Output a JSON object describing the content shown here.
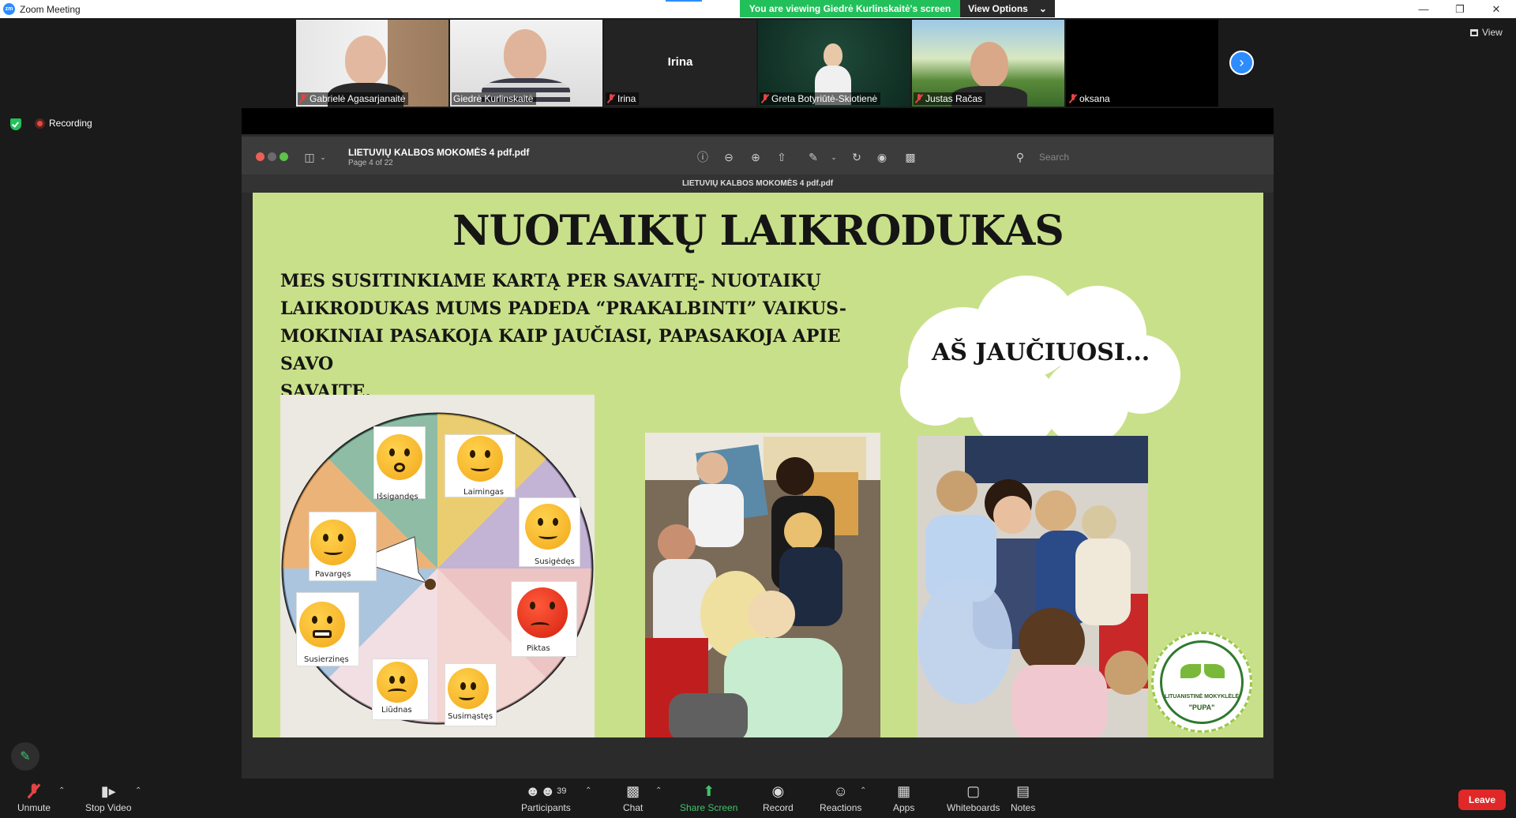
{
  "window": {
    "app_logo": "zm",
    "title": "Zoom Meeting",
    "controls": [
      "minimize-icon",
      "restore-icon",
      "close-icon"
    ]
  },
  "banner": {
    "viewing_text": "You are viewing Giedrė Kurlinskaitė's screen",
    "view_options_label": "View Options",
    "banner_color": "#22c05a"
  },
  "gallery": {
    "tiles": [
      {
        "name": "Gabrielė Agasarjanaitė",
        "muted": true,
        "video": true
      },
      {
        "name": "Giedrė Kurlinskaitė",
        "muted": false,
        "video": true,
        "active_speaker": true
      },
      {
        "name": "Irina",
        "muted": true,
        "video": false,
        "center_name": "Irina"
      },
      {
        "name": "Greta Botyriūtė-Skiotienė",
        "muted": true,
        "video": true
      },
      {
        "name": "Justas Račas",
        "muted": true,
        "video": true
      },
      {
        "name": "oksana",
        "muted": true,
        "video": false
      }
    ],
    "view_label": "View"
  },
  "status": {
    "recording_label": "Recording",
    "recording_color": "#e8483f"
  },
  "preview": {
    "file_name": "LIETUVIŲ KALBOS MOKOMĖS 4 pdf.pdf",
    "page_info": "Page 4 of 22",
    "tab_title": "LIETUVIŲ KALBOS MOKOMĖS 4 pdf.pdf",
    "search_placeholder": "Search"
  },
  "slide": {
    "title": "NUOTAIKŲ LAIKRODUKAS",
    "body_lines": [
      "MES SUSITINKIAME KARTĄ PER SAVAITĘ- NUOTAIKŲ",
      "LAIKRODUKAS MUMS PADEDA  “PRAKALBINTI” VAIKUS-",
      "MOKINIAI PASAKOJA KAIP JAUČIASI, PAPASAKOJA APIE SAVO",
      "SAVAITĘ."
    ],
    "cloud_text": "AŠ JAUČIUOSI...",
    "emotions": [
      "Išsigandęs",
      "Laimingas",
      "Pavargęs",
      "Susigėdęs",
      "Piktas",
      "Susierzinęs",
      "Liūdnas",
      "Susimąstęs"
    ],
    "logo_line1": "LITUANISTINĖ MOKYKLĖLĖ",
    "logo_line2": "\"PUPA\"",
    "background_color": "#c9e08a"
  },
  "toolbar": {
    "unmute": "Unmute",
    "stop_video": "Stop Video",
    "participants": "Participants",
    "participants_count": "39",
    "chat": "Chat",
    "share_screen": "Share Screen",
    "record": "Record",
    "reactions": "Reactions",
    "apps": "Apps",
    "whiteboards": "Whiteboards",
    "notes": "Notes",
    "leave": "Leave",
    "leave_color": "#e02828"
  }
}
